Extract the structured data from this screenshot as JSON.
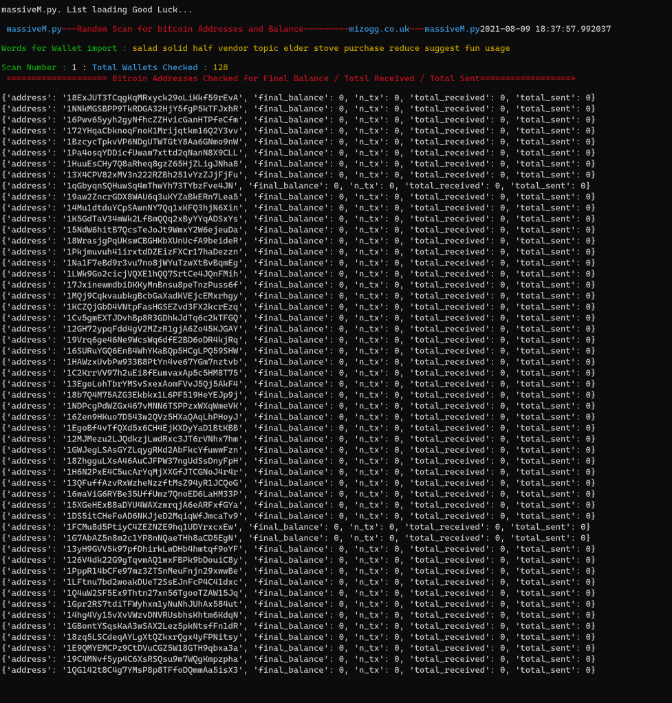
{
  "header": {
    "loading_line": "massiveM.py. List loading Good Luck...",
    "banner": {
      "script": " massiveM.py",
      "dash1": "---",
      "title": "Random Scan for bitcoin Addresses and Balance",
      "dash2": "---------",
      "site": "mizogg.co.uk",
      "dash3": "---",
      "script2": "massiveM.py",
      "timestamp": "2021-08-09 18:37:57.992037"
    },
    "mnemonic_label": "Words for Wallet import :",
    "mnemonic_words": "salad solid half vendor topic elder stove purchase reduce suggest fun usage",
    "scan_number_label": "Scan Number :",
    "scan_number_value": "1",
    "sep": " : ",
    "total_wallets_label": "Total Wallets Checked :",
    "total_wallets_value": "128",
    "rule": {
      "left": " <",
      "mid_eq_left": "===================",
      "title": " Bitcoin Addresses Checked for Final Balance / Total Received / Total Sent",
      "mid_eq_right": "==================",
      "right": ">"
    }
  },
  "rows": [
    {
      "address": "18ExJUT3TCqgKqMRxyck29oLiKkf59rEvA",
      "final_balance": 0,
      "n_tx": 0,
      "total_received": 0,
      "total_sent": 0
    },
    {
      "address": "1NNkMGSBPP9TkRDGA32HjY5fgP5kTFJxhR",
      "final_balance": 0,
      "n_tx": 0,
      "total_received": 0,
      "total_sent": 0
    },
    {
      "address": "16Pwv65yyh2gyNfhcZZHvicGanHTPfeCfm",
      "final_balance": 0,
      "n_tx": 0,
      "total_received": 0,
      "total_sent": 0
    },
    {
      "address": "172YHqaCbknoqFnoK1Mrijqtkm16Q2Y3vv",
      "final_balance": 0,
      "n_tx": 0,
      "total_received": 0,
      "total_sent": 0
    },
    {
      "address": "1BzcycTpkvVP6NDgUTWTGtY8Aa6GNmo9nW",
      "final_balance": 0,
      "n_tx": 0,
      "total_received": 0,
      "total_sent": 0
    },
    {
      "address": "1Pa4osqYDDicfUwam7xttd2qNanN8X9CLL",
      "final_balance": 0,
      "n_tx": 0,
      "total_received": 0,
      "total_sent": 0
    },
    {
      "address": "1HuuEsCHy7Q8aRheq8gzZ65HjZLigJNha8",
      "final_balance": 0,
      "n_tx": 0,
      "total_received": 0,
      "total_sent": 0
    },
    {
      "address": "13X4CPV82xMV3n222RZBh251vYzZJjFjFu",
      "final_balance": 0,
      "n_tx": 0,
      "total_received": 0,
      "total_sent": 0
    },
    {
      "address": "1qGbyqnSQHuwSq4mThwYh73TYbzFve4JN",
      "final_balance": 0,
      "n_tx": 0,
      "total_received": 0,
      "total_sent": 0
    },
    {
      "address": "19aw2ZncrGDX8WAU6q3uKYZaBkERn7Lea5",
      "final_balance": 0,
      "n_tx": 0,
      "total_received": 0,
      "total_sent": 0
    },
    {
      "address": "14Mu1dtduYCpSAwnNY7Qq1xKFQ3hjN6Xin",
      "final_balance": 0,
      "n_tx": 0,
      "total_received": 0,
      "total_sent": 0
    },
    {
      "address": "1K5GdTaV34mWk2LfBmQQq2xByYYqADSxYs",
      "final_balance": 0,
      "n_tx": 0,
      "total_received": 0,
      "total_sent": 0
    },
    {
      "address": "15NdW6hitB7QcsTeJoJt9WmxY2W6ejeuDa",
      "final_balance": 0,
      "n_tx": 0,
      "total_received": 0,
      "total_sent": 0
    },
    {
      "address": "18WrasjgPqUKswCBGHKbXUnUcfA9beideR",
      "final_balance": 0,
      "n_tx": 0,
      "total_received": 0,
      "total_sent": 0
    },
    {
      "address": "1Pkjmuvuh41irxtdDZEizFXCr17haDezzn",
      "final_balance": 0,
      "n_tx": 0,
      "total_received": 0,
      "total_sent": 0
    },
    {
      "address": "1Na1F7eBd9r3vu7no8jWYuTzwXtBvBqmEg",
      "final_balance": 0,
      "n_tx": 0,
      "total_received": 0,
      "total_sent": 0
    },
    {
      "address": "1LWk9Go2cicjVQXE1hQQ7SrtCe4JQnFMih",
      "final_balance": 0,
      "n_tx": 0,
      "total_received": 0,
      "total_sent": 0
    },
    {
      "address": "17JxinewmdbiDKKyMnBnsu8peTnzPuss6f",
      "final_balance": 0,
      "n_tx": 0,
      "total_received": 0,
      "total_sent": 0
    },
    {
      "address": "1MQj9CqkvaubkgBcbGaXadKVEjcEMxrhgy",
      "final_balance": 0,
      "n_tx": 0,
      "total_received": 0,
      "total_sent": 0
    },
    {
      "address": "1KCZQjGbD4VNtpFasHGSEZvd3FX2kcrEzq",
      "final_balance": 0,
      "n_tx": 0,
      "total_received": 0,
      "total_sent": 0
    },
    {
      "address": "1Cv5gmEXTJDvhBp8R3GDhkJdTq6c2kTFGQ",
      "final_balance": 0,
      "n_tx": 0,
      "total_received": 0,
      "total_sent": 0
    },
    {
      "address": "12GH72ypqFdd4gV2MZzR1gjA6Zo45KJGAY",
      "final_balance": 0,
      "n_tx": 0,
      "total_received": 0,
      "total_sent": 0
    },
    {
      "address": "19Vrq6ge46Ne9WcsWq6dfE2BD6oDR4kjRq",
      "final_balance": 0,
      "n_tx": 0,
      "total_received": 0,
      "total_sent": 0
    },
    {
      "address": "16SURuYGQ6EnB4WhYKaBQp5HCgLPQ59SHW",
      "final_balance": 0,
      "n_tx": 0,
      "total_received": 0,
      "total_sent": 0
    },
    {
      "address": "1HAWzxUvbPw933B8PtYn4ve67YGm7nztvb",
      "final_balance": 0,
      "n_tx": 0,
      "total_received": 0,
      "total_sent": 0
    },
    {
      "address": "1C2KrrVV97h2uEi8fEumvaxAp5c5HM8T75",
      "final_balance": 0,
      "n_tx": 0,
      "total_received": 0,
      "total_sent": 0
    },
    {
      "address": "13EgoLohTbrYMSvSxexAomFVvJ5Qj5AkF4",
      "final_balance": 0,
      "n_tx": 0,
      "total_received": 0,
      "total_sent": 0
    },
    {
      "address": "18b7Q4M75AZG3Ekbkx1L6PF519HeYEJp9j",
      "final_balance": 0,
      "n_tx": 0,
      "total_received": 0,
      "total_sent": 0
    },
    {
      "address": "1NDPcgPdWZGx467vMNN6TSPPzxWXqWmeVK",
      "final_balance": 0,
      "n_tx": 0,
      "total_received": 0,
      "total_sent": 0
    },
    {
      "address": "16Zen9HKuo7D543w2QVz5HXaQAqLhPHoyJ",
      "final_balance": 0,
      "n_tx": 0,
      "total_received": 0,
      "total_sent": 0
    },
    {
      "address": "1EgoBf4vTfQXd5x6CH4EjKXDyYaD1BtKBB",
      "final_balance": 0,
      "n_tx": 0,
      "total_received": 0,
      "total_sent": 0
    },
    {
      "address": "12MJMezu2LJQdkzjLwdRxc3JT6rVNhx7hm",
      "final_balance": 0,
      "n_tx": 0,
      "total_received": 0,
      "total_sent": 0
    },
    {
      "address": "1GWJegLSAsGYZLqygRKd2AbFkcYfuwwFzn",
      "final_balance": 0,
      "n_tx": 0,
      "total_received": 0,
      "total_sent": 0
    },
    {
      "address": "18ZhgguLXsA46AuCJFPW37ngUdSsDnyFpH",
      "final_balance": 0,
      "n_tx": 0,
      "total_received": 0,
      "total_sent": 0
    },
    {
      "address": "1H6N2PxE4C5ucArYqMjXXGfJTCGNoJ4r4r",
      "final_balance": 0,
      "n_tx": 0,
      "total_received": 0,
      "total_sent": 0
    },
    {
      "address": "13QFuffAzvRxWzheNzzftMsZ94yR1JCQoG",
      "final_balance": 0,
      "n_tx": 0,
      "total_received": 0,
      "total_sent": 0
    },
    {
      "address": "16waViG6RYBe35UffUmz7QnoED6LaHM33P",
      "final_balance": 0,
      "n_tx": 0,
      "total_received": 0,
      "total_sent": 0
    },
    {
      "address": "15XGeHExB8aDYU4WAXzwrqjA6eARFxfGYa",
      "final_balance": 0,
      "n_tx": 0,
      "total_received": 0,
      "total_sent": 0
    },
    {
      "address": "1DS5itCHeFoAD6NKJjeD2MqiqWfJmcaTv9",
      "final_balance": 0,
      "n_tx": 0,
      "total_received": 0,
      "total_sent": 0
    },
    {
      "address": "1FCMu8d5PtiyC4ZEZNZE9hq1UDYrxcxEw",
      "final_balance": 0,
      "n_tx": 0,
      "total_received": 0,
      "total_sent": 0
    },
    {
      "address": "1G7AbAZ5n8m2c1YP8nNQaeTHh8aCD5EgN",
      "final_balance": 0,
      "n_tx": 0,
      "total_received": 0,
      "total_sent": 0
    },
    {
      "address": "13yH9GVV5k97pfDhirkLwDHb4hmtqf9oYF",
      "final_balance": 0,
      "n_tx": 0,
      "total_received": 0,
      "total_sent": 0
    },
    {
      "address": "126V4dk22G9gTqvmAQ1wxFBPk9bDouiC8y",
      "final_balance": 0,
      "n_tx": 0,
      "total_received": 0,
      "total_sent": 0
    },
    {
      "address": "1PppR14bCFe97mz3ZTSnMeuFnjn29xwwBe",
      "final_balance": 0,
      "n_tx": 0,
      "total_received": 0,
      "total_sent": 0
    },
    {
      "address": "1LFtnu7bd2woakDUeT2SsEJnFcP4C41dxc",
      "final_balance": 0,
      "n_tx": 0,
      "total_received": 0,
      "total_sent": 0
    },
    {
      "address": "1Q4uW2SF5Ex9Thtn27xn56TgooTZAW15Jq",
      "final_balance": 0,
      "n_tx": 0,
      "total_received": 0,
      "total_sent": 0
    },
    {
      "address": "1Gpr2RS7tdiTFWyhxm1yNuNhJUhAx584ut",
      "final_balance": 0,
      "n_tx": 0,
      "total_received": 0,
      "total_sent": 0
    },
    {
      "address": "14hg4Vy15vXvVWzvDNVRUsbhsKhtm6KdqN",
      "final_balance": 0,
      "n_tx": 0,
      "total_received": 0,
      "total_sent": 0
    },
    {
      "address": "1GBontYSqsKaA3wSAX2Lez5pkNtsfFn1dR",
      "final_balance": 0,
      "n_tx": 0,
      "total_received": 0,
      "total_sent": 0
    },
    {
      "address": "18zq5LSCdeqAYLgXtQZkxrQgx4yFPNitsy",
      "final_balance": 0,
      "n_tx": 0,
      "total_received": 0,
      "total_sent": 0
    },
    {
      "address": "1E9QMYEMCPz9CtDVuCGZ5W18GTH9qbxa3a",
      "final_balance": 0,
      "n_tx": 0,
      "total_received": 0,
      "total_sent": 0
    },
    {
      "address": "19C4MNvf5yp4C6XsRSQsu9m7WQgKmpzpha",
      "final_balance": 0,
      "n_tx": 0,
      "total_received": 0,
      "total_sent": 0
    },
    {
      "address": "1QG142t8C4g7YMsP8p8TFfoDQmmAa5isX3",
      "final_balance": 0,
      "n_tx": 0,
      "total_received": 0,
      "total_sent": 0
    }
  ]
}
